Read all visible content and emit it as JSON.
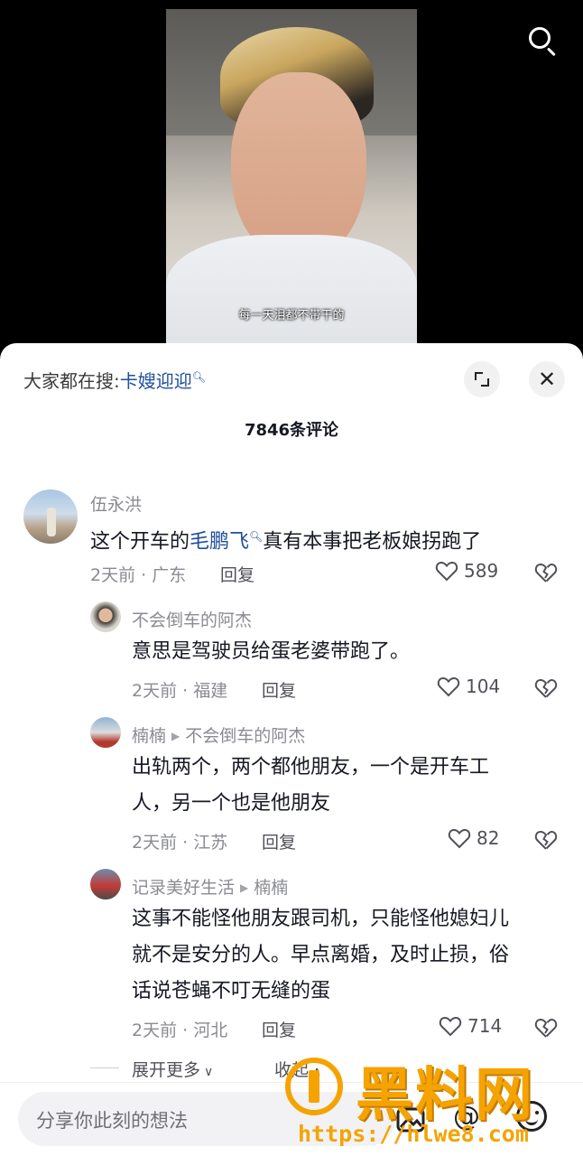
{
  "video": {
    "subtitle": "每一天泪都不带干的"
  },
  "sheet": {
    "hot_search_prefix": "大家都在搜:",
    "hot_search_term": "卡嫂迎迎",
    "comment_count": "7846条评论"
  },
  "comments": [
    {
      "username": "伍永洪",
      "text_before": "这个开车的",
      "mention": "毛鹏飞",
      "text_after": "真有本事把老板娘拐跑了",
      "meta": "2天前 · 广东",
      "reply_label": "回复",
      "likes": "589"
    },
    {
      "username": "不会倒车的阿杰",
      "text": "意思是驾驶员给蛋老婆带跑了。",
      "meta": "2天前 · 福建",
      "reply_label": "回复",
      "likes": "104"
    },
    {
      "username": "楠楠",
      "reply_to": "不会倒车的阿杰",
      "text_line1": "出轨两个，两个都他朋友，一个是开车工",
      "text_line2": "人，另一个也是他朋友",
      "meta": "2天前 · 江苏",
      "reply_label": "回复",
      "likes": "82"
    },
    {
      "username": "记录美好生活",
      "reply_to": "楠楠",
      "text_line1": "这事不能怪他朋友跟司机，只能怪他媳妇儿",
      "text_line2": "就不是安分的人。早点离婚，及时止损，俗",
      "text_line3": "话说苍蝇不叮无缝的蛋",
      "meta": "2天前 · 河北",
      "reply_label": "回复",
      "likes": "714"
    }
  ],
  "footer": {
    "expand_more": "展开更多",
    "collapse": "收起",
    "input_placeholder": "分享你此刻的想法"
  },
  "watermark": {
    "title": "黑料网",
    "url": "https://hlwe8.com"
  },
  "colors": {
    "mention": "#1f4d9c",
    "watermark": "#f5a300"
  }
}
